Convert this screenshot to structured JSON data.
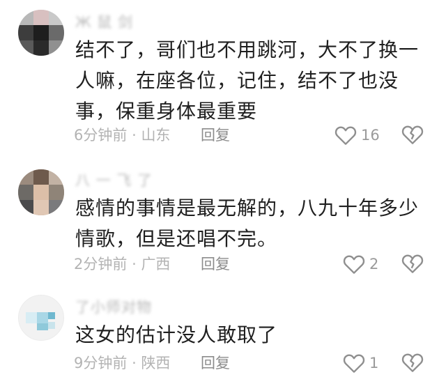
{
  "comments": [
    {
      "username": "Ж￼ 鼠 剑",
      "text": "结不了，哥们也不用跳河，大不了换一人嘛，在座各位，记住，结不了也没事，保重身体最重要",
      "time": "6分钟前",
      "separator": "·",
      "location": "山东",
      "reply_label": "回复",
      "likes": "16"
    },
    {
      "username": "八 一 飞 了",
      "text": "感情的事情是最无解的，八九十年多少情歌，但是还唱不完。",
      "time": "2分钟前",
      "separator": "·",
      "location": "广西",
      "reply_label": "回复",
      "likes": "2"
    },
    {
      "username": "了小师对物",
      "text": "这女的估计没人敢取了",
      "time": "9分钟前",
      "separator": "·",
      "location": "陕西",
      "reply_label": "回复",
      "likes": "1"
    }
  ],
  "icons": {
    "like": "heart-outline-icon",
    "dislike": "broken-heart-icon"
  },
  "colors": {
    "text": "#1f1f1f",
    "meta": "#b3b3b3",
    "icon": "#8f8f8f"
  }
}
